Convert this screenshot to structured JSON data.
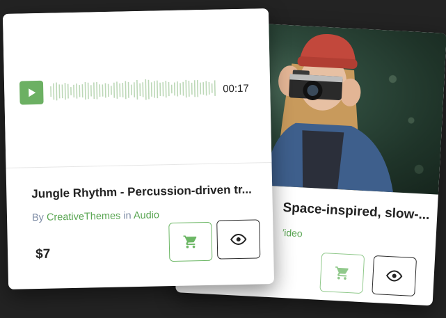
{
  "colors": {
    "accent": "#6cb063",
    "link": "#5aa653",
    "byline": "#7c8ba4",
    "background": "#232323"
  },
  "front_card": {
    "audio_time": "00:17",
    "title": "Jungle Rhythm - Percussion-driven tr...",
    "by_prefix": "By",
    "author": "CreativeThemes",
    "in_word": "in",
    "category": "Audio",
    "price": "$7",
    "icons": {
      "play": "play-icon",
      "cart": "cart-icon",
      "view": "eye-icon"
    }
  },
  "back_card": {
    "title": "Space-inspired, slow-...",
    "category": "Video",
    "icons": {
      "cart": "cart-icon",
      "view": "eye-icon"
    }
  }
}
